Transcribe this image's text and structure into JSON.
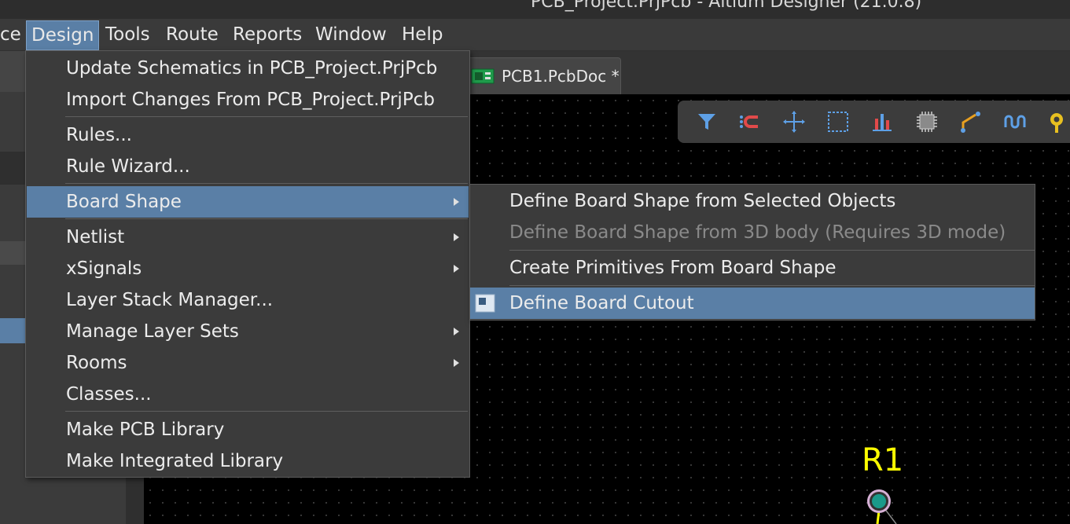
{
  "window": {
    "title": "PCB_Project.PrjPcb - Altium Designer (21.0.8)"
  },
  "menubar": {
    "items": [
      {
        "label": "ce"
      },
      {
        "label": "Design",
        "active": true
      },
      {
        "label": "Tools"
      },
      {
        "label": "Route"
      },
      {
        "label": "Reports"
      },
      {
        "label": "Window"
      },
      {
        "label": "Help"
      }
    ]
  },
  "document_tab": {
    "label": "PCB1.PcbDoc *",
    "icon": "pcb-document-icon"
  },
  "toolbar": {
    "icons": [
      "filter-icon",
      "interactive-route-icon",
      "move-icon",
      "select-rect-icon",
      "bar-chart-icon",
      "component-icon",
      "route-icon",
      "wiggle-icon",
      "pin-icon"
    ]
  },
  "design_menu": {
    "items": [
      {
        "label": "Update Schematics in PCB_Project.PrjPcb",
        "submenu": false
      },
      {
        "label": "Import Changes From PCB_Project.PrjPcb",
        "submenu": false
      },
      {
        "label": "Rules...",
        "submenu": false
      },
      {
        "label": "Rule Wizard...",
        "submenu": false
      },
      {
        "label": "Board Shape",
        "submenu": true,
        "highlighted": true
      },
      {
        "label": "Netlist",
        "submenu": true
      },
      {
        "label": "xSignals",
        "submenu": true
      },
      {
        "label": "Layer Stack Manager...",
        "submenu": false
      },
      {
        "label": "Manage Layer Sets",
        "submenu": true
      },
      {
        "label": "Rooms",
        "submenu": true
      },
      {
        "label": "Classes...",
        "submenu": false
      },
      {
        "label": "Make PCB Library",
        "submenu": false
      },
      {
        "label": "Make Integrated Library",
        "submenu": false
      }
    ]
  },
  "board_shape_submenu": {
    "items": [
      {
        "label": "Define Board Shape from Selected Objects",
        "enabled": true
      },
      {
        "label": "Define Board Shape from 3D body (Requires 3D mode)",
        "enabled": false
      },
      {
        "label": "Create Primitives From Board Shape",
        "enabled": true
      },
      {
        "label": "Define Board Cutout",
        "enabled": true,
        "highlighted": true,
        "icon": "board-cutout-icon"
      }
    ]
  },
  "canvas": {
    "designator": "R1",
    "designator_color": "#ffff00",
    "pad_color": "#1a9a8a"
  },
  "colors": {
    "accent": "#5a7fa6",
    "menu_bg": "#3b3b3b",
    "canvas_bg": "#000000"
  }
}
